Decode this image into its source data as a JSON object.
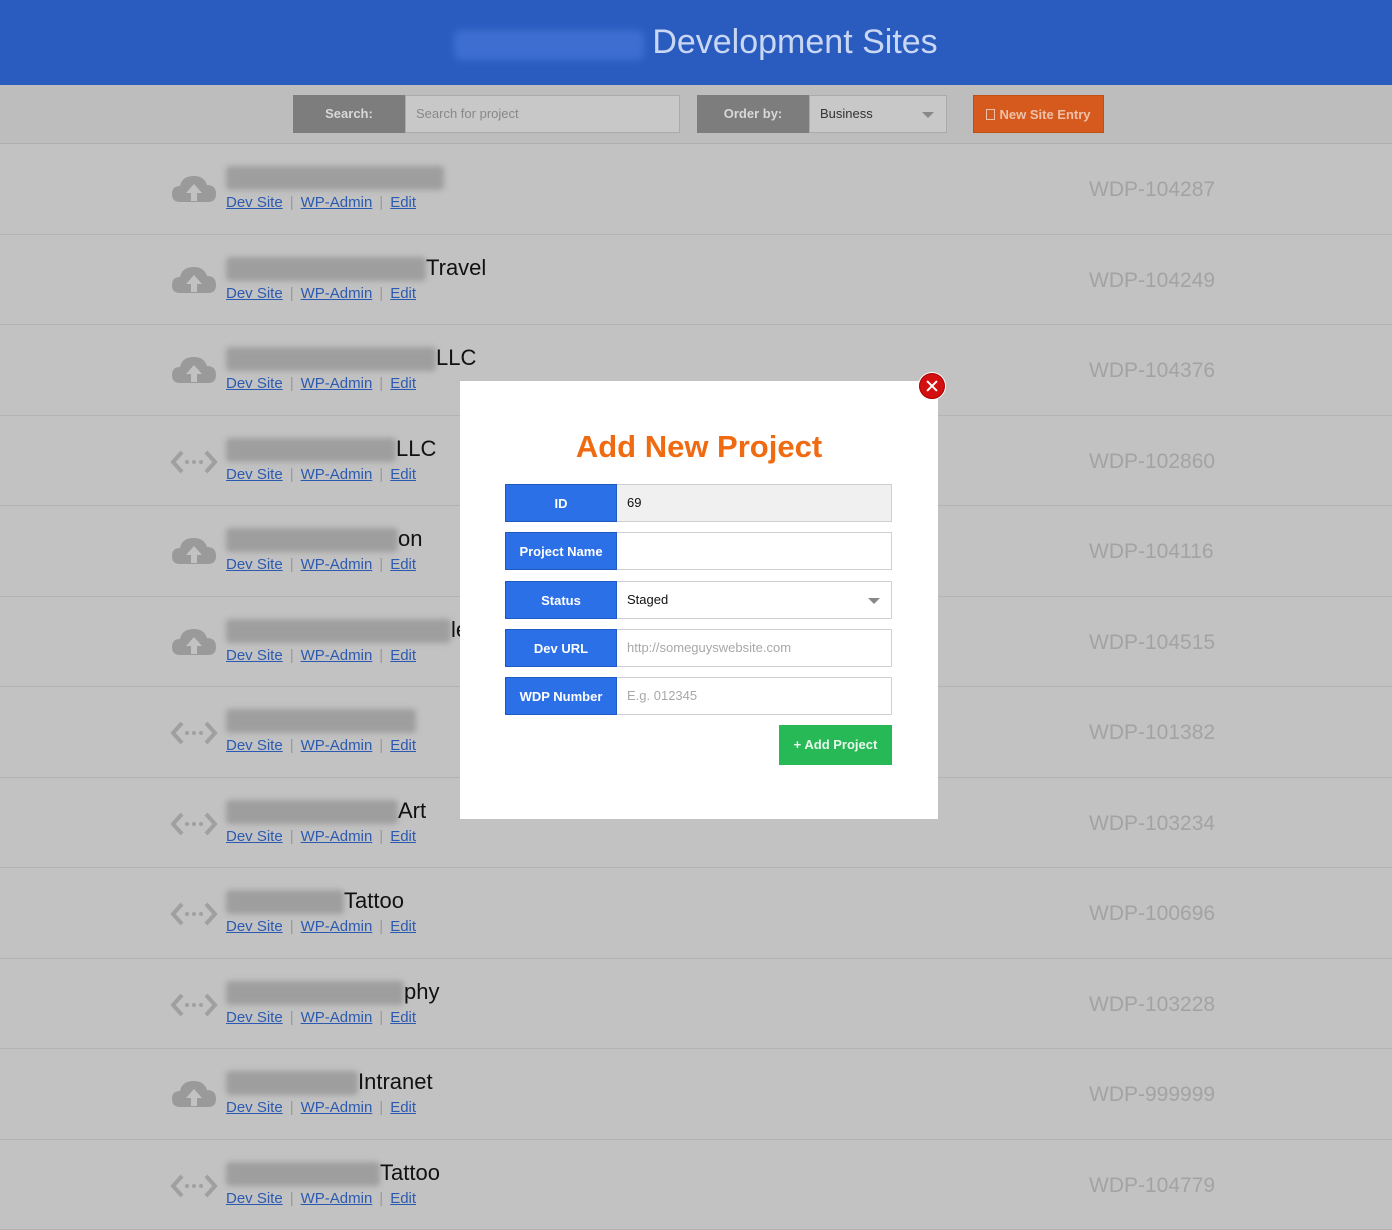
{
  "header": {
    "title": "Development Sites"
  },
  "toolbar": {
    "search_label": "Search:",
    "search_placeholder": "Search for project",
    "order_label": "Order by:",
    "order_value": "Business",
    "new_entry_label": "New Site Entry"
  },
  "row_links": {
    "dev_site": "Dev Site",
    "wp_admin": "WP-Admin",
    "edit": "Edit",
    "separator": "|"
  },
  "rows": [
    {
      "name_suffix": "",
      "wdp": "WDP-104287",
      "icon": "cloud-upload-icon"
    },
    {
      "name_suffix": "Travel",
      "wdp": "WDP-104249",
      "icon": "cloud-upload-icon"
    },
    {
      "name_suffix": "LLC",
      "wdp": "WDP-104376",
      "icon": "cloud-upload-icon"
    },
    {
      "name_suffix": "LLC",
      "wdp": "WDP-102860",
      "icon": "code-arrows-icon"
    },
    {
      "name_suffix": "on",
      "wdp": "WDP-104116",
      "icon": "cloud-upload-icon"
    },
    {
      "name_suffix": "le",
      "wdp": "WDP-104515",
      "icon": "cloud-upload-icon"
    },
    {
      "name_suffix": "",
      "wdp": "WDP-101382",
      "icon": "code-arrows-icon"
    },
    {
      "name_suffix": "Art",
      "wdp": "WDP-103234",
      "icon": "code-arrows-icon"
    },
    {
      "name_suffix": "Tattoo",
      "wdp": "WDP-100696",
      "icon": "code-arrows-icon"
    },
    {
      "name_suffix": "phy",
      "wdp": "WDP-103228",
      "icon": "code-arrows-icon"
    },
    {
      "name_suffix": "Intranet",
      "wdp": "WDP-999999",
      "icon": "cloud-upload-icon"
    },
    {
      "name_suffix": "Tattoo",
      "wdp": "WDP-104779",
      "icon": "code-arrows-icon"
    }
  ],
  "modal": {
    "title": "Add New Project",
    "fields": {
      "id": {
        "label": "ID",
        "value": "69"
      },
      "project_name": {
        "label": "Project Name",
        "value": ""
      },
      "status": {
        "label": "Status",
        "value": "Staged"
      },
      "dev_url": {
        "label": "Dev URL",
        "placeholder": "http://someguyswebsite.com"
      },
      "wdp_number": {
        "label": "WDP Number",
        "placeholder": "E.g. 012345"
      }
    },
    "submit_label": "+ Add Project"
  },
  "colors": {
    "header_bg": "#2a5cc0",
    "accent_orange": "#f06a12",
    "label_blue": "#2b70e6",
    "submit_green": "#27b956",
    "close_red": "#d40f0f"
  }
}
